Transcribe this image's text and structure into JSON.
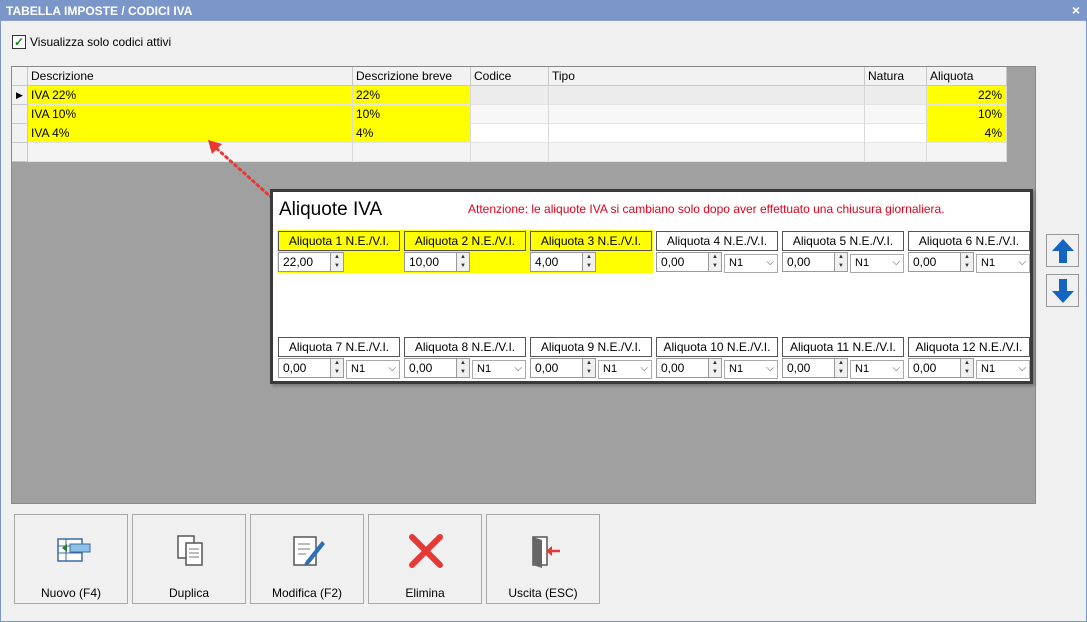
{
  "window": {
    "title": "TABELLA IMPOSTE / CODICI IVA",
    "close_glyph": "×"
  },
  "filter": {
    "label": "Visualizza solo codici attivi",
    "checked": true,
    "check_glyph": "✓"
  },
  "grid": {
    "columns": [
      "Descrizione",
      "Descrizione breve",
      "Codice",
      "Tipo",
      "Natura",
      "Aliquota"
    ],
    "current_row_marker": "▶",
    "rows": [
      {
        "descrizione": "IVA 22%",
        "breve": "22%",
        "codice": "",
        "tipo": "",
        "natura": "",
        "aliquota": "22%"
      },
      {
        "descrizione": "IVA 10%",
        "breve": "10%",
        "codice": "",
        "tipo": "",
        "natura": "",
        "aliquota": "10%"
      },
      {
        "descrizione": "IVA 4%",
        "breve": "4%",
        "codice": "",
        "tipo": "",
        "natura": "",
        "aliquota": "4%"
      }
    ]
  },
  "popup": {
    "title": "Aliquote IVA",
    "warning": "Attenzione: le aliquote IVA si cambiano solo dopo aver effettuato una chiusura giornaliera.",
    "rates": [
      {
        "label": "Aliquota 1  N.E./V.I.",
        "value": "22,00",
        "natura": ""
      },
      {
        "label": "Aliquota 2  N.E./V.I.",
        "value": "10,00",
        "natura": ""
      },
      {
        "label": "Aliquota 3  N.E./V.I.",
        "value": "4,00",
        "natura": ""
      },
      {
        "label": "Aliquota 4  N.E./V.I.",
        "value": "0,00",
        "natura": "N1"
      },
      {
        "label": "Aliquota 5  N.E./V.I.",
        "value": "0,00",
        "natura": "N1"
      },
      {
        "label": "Aliquota 6  N.E./V.I.",
        "value": "0,00",
        "natura": "N1"
      },
      {
        "label": "Aliquota 7  N.E./V.I.",
        "value": "0,00",
        "natura": "N1"
      },
      {
        "label": "Aliquota 8  N.E./V.I.",
        "value": "0,00",
        "natura": "N1"
      },
      {
        "label": "Aliquota 9  N.E./V.I.",
        "value": "0,00",
        "natura": "N1"
      },
      {
        "label": "Aliquota 10 N.E./V.I.",
        "value": "0,00",
        "natura": "N1"
      },
      {
        "label": "Aliquota 11 N.E./V.I.",
        "value": "0,00",
        "natura": "N1"
      },
      {
        "label": "Aliquota 12 N.E./V.I.",
        "value": "0,00",
        "natura": "N1"
      }
    ]
  },
  "toolbar": {
    "buttons": [
      {
        "label": "Nuovo (F4)",
        "icon": "new-row-icon"
      },
      {
        "label": "Duplica",
        "icon": "duplicate-icon"
      },
      {
        "label": "Modifica (F2)",
        "icon": "edit-icon"
      },
      {
        "label": "Elimina",
        "icon": "delete-icon"
      },
      {
        "label": "Uscita (ESC)",
        "icon": "exit-icon"
      }
    ]
  },
  "colors": {
    "highlight": "#ffff00",
    "warning": "#e0001a",
    "arrow": "#1565c0",
    "annotation": "#e53935"
  }
}
